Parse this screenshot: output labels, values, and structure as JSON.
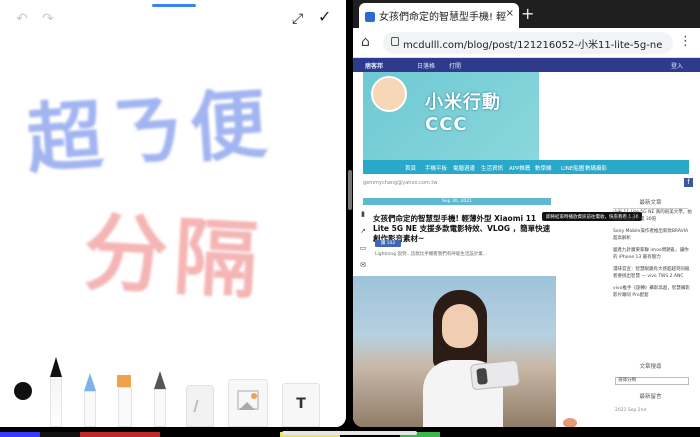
{
  "notes": {
    "handwriting_blue": "超ㄋ便",
    "handwriting_red": "分隔"
  },
  "browser": {
    "tab_title": "女孩們命定的智慧型手機! 輕",
    "close_label": "×",
    "new_tab_label": "+",
    "url": "mcdulll.com/blog/post/121216052-小米11-lite-5g-ne"
  },
  "site": {
    "top_nav": [
      "痞客邦",
      "日落格",
      "打開",
      "登入"
    ],
    "banner_title": "小米行動CCC",
    "sub_nav": [
      "首頁",
      "手機平板",
      "電腦週邊",
      "生活資訊",
      "APP推薦",
      "數學機",
      "LINE貼圖",
      "數碼攝影"
    ],
    "email": "gemmychang@yahoo.com.tw",
    "date": "Sep 30, 2021",
    "post_title": "女孩們命定的智慧型手機! 輕薄外型 Xiaomi 11 Lite 5G NE  支援多款電影特效、VLOG ，簡單快速創作影音素材~",
    "popup_text": "即將結束時播放資訊前往電收，快來看看 1.38",
    "like_label": "讚 102",
    "excerpt": "Lightning 說到.. 這款比手機看我們有呼吸生活設計業...",
    "sidebar_heading": "最新文章",
    "sidebar_items": [
      "小米 11 Lite 5G NE 真的很美大學，拍照技術還真不錯 30倍",
      "Sony Mobile操作者推出新款BRAVIA 超高解析",
      "國產九針廣東家聯 imoo問題亂，讓你的 iPhone 13 最有魅力",
      "漫味官宣：智慧眼鏡有大感超越到同級者要挑出智慧 — vivo TWS 2 ANC",
      "vivo推手《旋轉》攝影高超，智慧攝影影片聯同 Pro配套"
    ],
    "sidebar_heading2": "文章搜尋",
    "select_label": "選擇分類",
    "sidebar_heading3": "最新留言",
    "sidebar_footer": "2021 Sep 2nd"
  }
}
